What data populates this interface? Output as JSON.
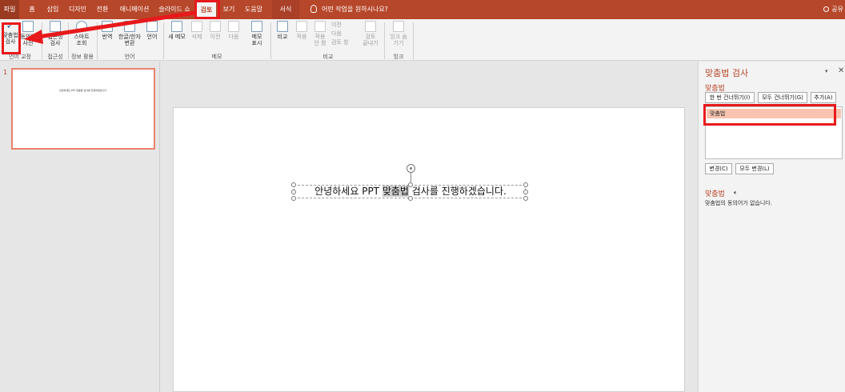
{
  "tabs": [
    {
      "label": "파일"
    },
    {
      "label": "홈"
    },
    {
      "label": "삽입"
    },
    {
      "label": "디자인"
    },
    {
      "label": "전환"
    },
    {
      "label": "애니메이션"
    },
    {
      "label": "슬라이드 쇼"
    },
    {
      "label": "검토"
    },
    {
      "label": "보기"
    },
    {
      "label": "도움말"
    },
    {
      "label": "서식"
    }
  ],
  "tellme": "어떤 작업을 원하시나요?",
  "share": "공유",
  "ribbon": {
    "spell": "맞춤법\n검사",
    "thesaurus": "동의어\n사전",
    "proofing_group": "언어 교정",
    "accessibility": "접근성\n검사",
    "accessibility_group": "접근성",
    "smart_lookup": "스마트\n조회",
    "insights_group": "정보 활용",
    "translate": "번역",
    "hanja": "한글/한자\n변환",
    "language": "언어",
    "language_group": "언어",
    "new_comment": "새 메모",
    "delete": "삭제",
    "previous": "이전",
    "next": "다음",
    "show_comments": "메모\n표시",
    "comments_group": "메모",
    "compare": "비교",
    "accept": "적용",
    "reject": "적용\n안 함",
    "prev_change": "이전",
    "next_change": "다음",
    "review_pane": "검토 창",
    "end_review": "검토\n끝내기",
    "compare_group": "비교",
    "ink": "잉크 숨\n기기",
    "ink_group": "잉크"
  },
  "slide": {
    "number": "1",
    "text_before": "안녕하세요 PPT ",
    "text_highlight": "맞춤법",
    "text_after": " 검사를 진행하겠습니다.",
    "thumb_text": "안녕하세요 PPT 맞춤법 검사를 진행하겠습니다."
  },
  "pane": {
    "title": "맞춤법 검사",
    "word": "맞춤법",
    "ignore_once": "한 번 건너뛰기(I)",
    "ignore_all": "모두 건너뛰기(G)",
    "add": "추가(A)",
    "suggestion": "맞춤법",
    "change": "변경(C)",
    "change_all": "모두 변경(L)",
    "word2": "맞춤법",
    "definition": "맞춤법의 동의어가 없습니다."
  }
}
